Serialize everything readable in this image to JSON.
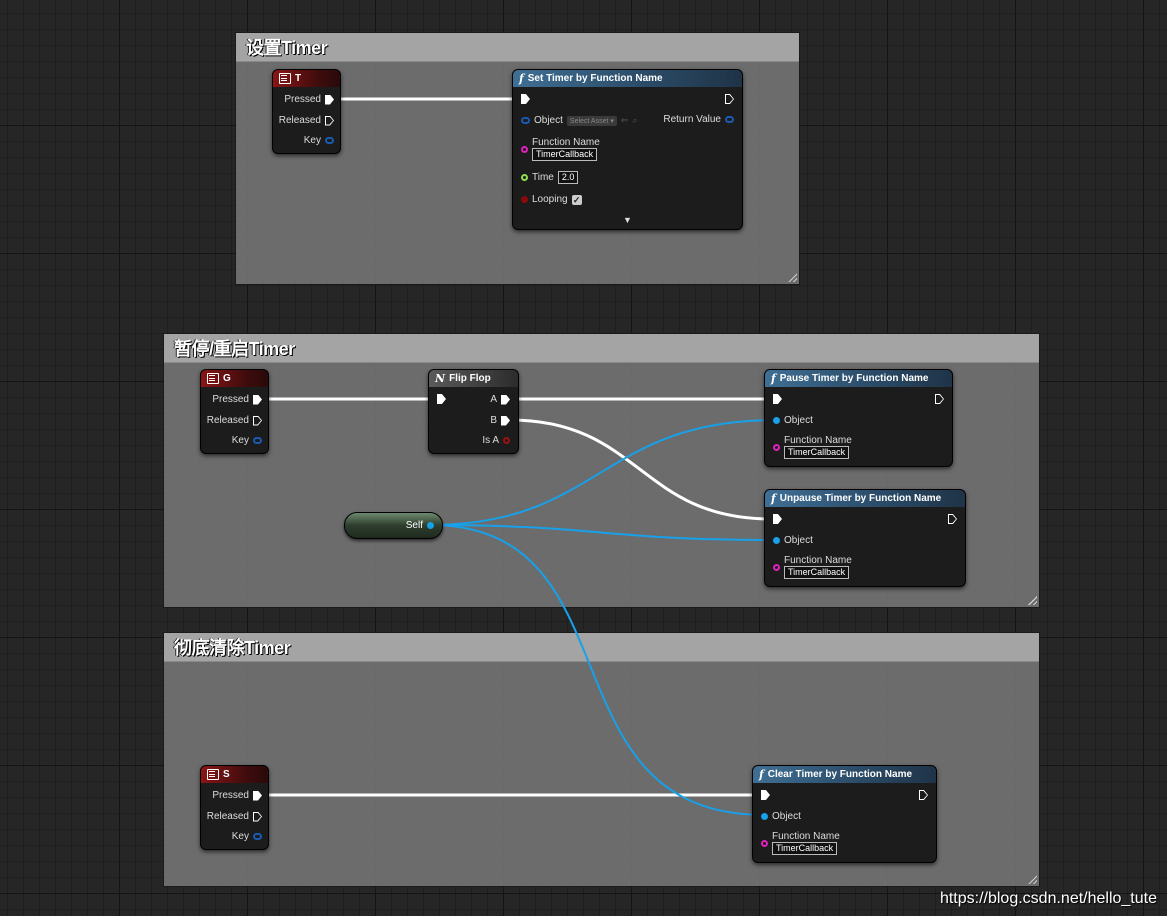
{
  "comments": [
    {
      "title": "设置Timer"
    },
    {
      "title": "暂停/重启Timer"
    },
    {
      "title": "彻底清除Timer"
    }
  ],
  "key_nodes": [
    {
      "key": "T",
      "pressed": "Pressed",
      "released": "Released",
      "key_label": "Key"
    },
    {
      "key": "G",
      "pressed": "Pressed",
      "released": "Released",
      "key_label": "Key"
    },
    {
      "key": "S",
      "pressed": "Pressed",
      "released": "Released",
      "key_label": "Key"
    }
  ],
  "set_timer": {
    "title": "Set Timer by Function Name",
    "object_label": "Object",
    "select_asset": "Select Asset",
    "return_value": "Return Value",
    "function_name_label": "Function Name",
    "function_name_value": "TimerCallback",
    "time_label": "Time",
    "time_value": "2.0",
    "looping_label": "Looping",
    "looping_checked": true
  },
  "flip_flop": {
    "title": "Flip Flop",
    "a": "A",
    "b": "B",
    "is_a": "Is A"
  },
  "pause_timer": {
    "title": "Pause Timer by Function Name",
    "object_label": "Object",
    "function_name_label": "Function Name",
    "function_name_value": "TimerCallback"
  },
  "unpause_timer": {
    "title": "Unpause Timer by Function Name",
    "object_label": "Object",
    "function_name_label": "Function Name",
    "function_name_value": "TimerCallback"
  },
  "clear_timer": {
    "title": "Clear Timer by Function Name",
    "object_label": "Object",
    "function_name_label": "Function Name",
    "function_name_value": "TimerCallback"
  },
  "self_node": {
    "label": "Self"
  },
  "watermark": "https://blog.csdn.net/hello_tute",
  "colors": {
    "exec_wire": "#ffffff",
    "object_wire": "#18a0e8",
    "key_header": "#8a1515",
    "function_header": "#3f6f94",
    "string_pin": "#e020c0",
    "float_pin": "#8ee050"
  }
}
